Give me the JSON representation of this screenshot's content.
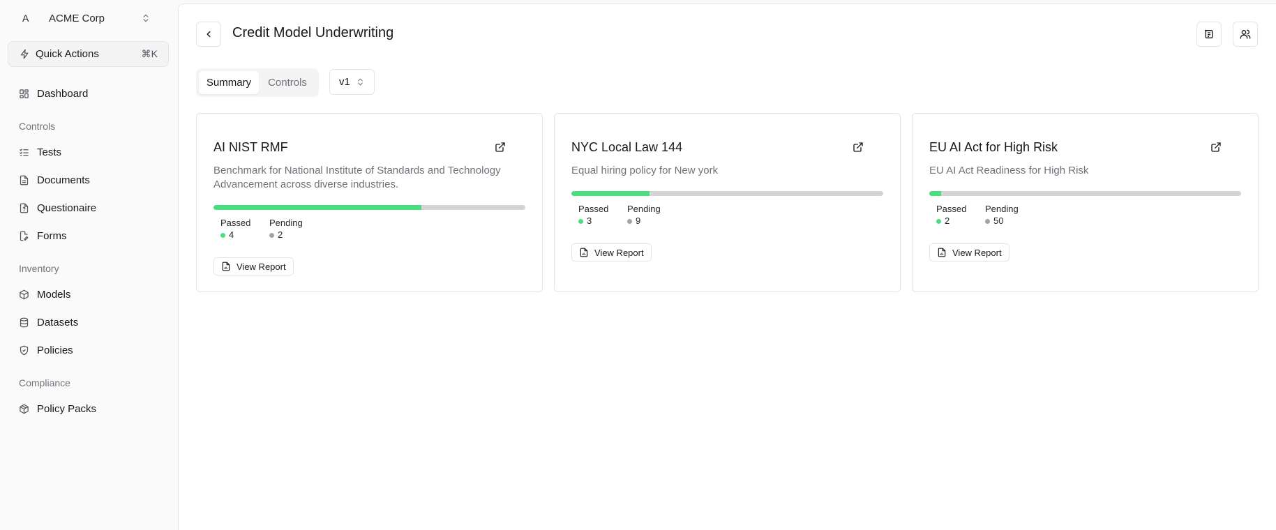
{
  "org": {
    "avatar_letter": "A",
    "name": "ACME Corp"
  },
  "quick_actions": {
    "label": "Quick Actions",
    "shortcut": "⌘K"
  },
  "nav": {
    "dashboard": "Dashboard",
    "controls_section": "Controls",
    "tests": "Tests",
    "documents": "Documents",
    "questionnaire": "Questionaire",
    "forms": "Forms",
    "inventory_section": "Inventory",
    "models": "Models",
    "datasets": "Datasets",
    "policies": "Policies",
    "compliance_section": "Compliance",
    "policy_packs": "Policy Packs"
  },
  "header": {
    "title": "Credit Model Underwriting"
  },
  "tabs": [
    {
      "label": "Summary",
      "active": true
    },
    {
      "label": "Controls",
      "active": false
    }
  ],
  "version": {
    "selected": "v1"
  },
  "colors": {
    "passed": "#4ade80",
    "pending": "#a1a1aa",
    "bar_track": "#d4d4d4"
  },
  "cards": [
    {
      "title": "AI NIST RMF",
      "description": "Benchmark for National Institute of Standards and Technology Advancement across diverse industries.",
      "passed_label": "Passed",
      "passed": "4",
      "pending_label": "Pending",
      "pending": "2",
      "progress_fraction": 0.667,
      "button": "View Report"
    },
    {
      "title": "NYC Local Law 144",
      "description": "Equal hiring policy for New york",
      "passed_label": "Passed",
      "passed": "3",
      "pending_label": "Pending",
      "pending": "9",
      "progress_fraction": 0.25,
      "button": "View Report"
    },
    {
      "title": "EU AI Act for High Risk",
      "description": "EU AI Act Readiness for High Risk",
      "passed_label": "Passed",
      "passed": "2",
      "pending_label": "Pending",
      "pending": "50",
      "progress_fraction": 0.038,
      "button": "View Report"
    }
  ]
}
